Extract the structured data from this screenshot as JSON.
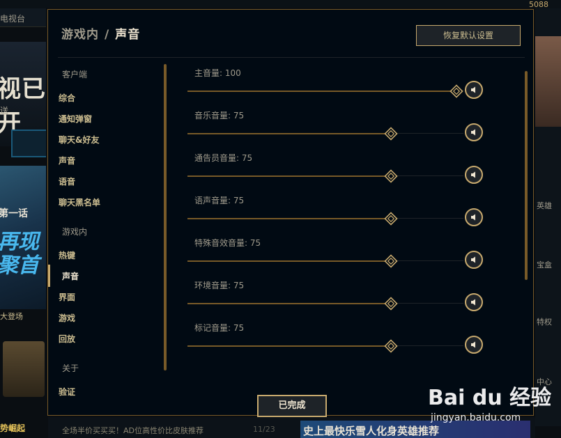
{
  "background": {
    "gold_amount": "5088",
    "left_nav_label": "电视台",
    "banner_big_text": "视已开",
    "banner_small_text": "送",
    "promo_line1": "第一话",
    "promo_line2": "再现",
    "promo_line3": "聚首",
    "promo_caption": "大登场",
    "bottom_left_news": "全场半价买买买！AD位高性价比皮肤推荐",
    "bottom_page": "11/23",
    "bottom_right_banner": "史上最快乐雪人化身英雄推荐",
    "left_footer": "势崛起",
    "right_labels": [
      "英雄",
      "宝盒",
      "特权",
      "中心"
    ]
  },
  "modal": {
    "breadcrumb_parent": "游戏内",
    "breadcrumb_sep": "/",
    "breadcrumb_current": "声音",
    "reset_button": "恢复默认设置",
    "done_button": "已完成"
  },
  "sidebar": {
    "section_client": "客户端",
    "client_items": [
      "综合",
      "通知弹窗",
      "聊天&好友",
      "声音",
      "语音",
      "聊天黑名单"
    ],
    "section_ingame": "游戏内",
    "ingame_items": [
      "热键",
      "声音",
      "界面",
      "游戏",
      "回放"
    ],
    "active_item": "声音",
    "section_about": "关于",
    "about_items": [
      "验证"
    ]
  },
  "volumes": [
    {
      "label": "主音量: 100",
      "value": 100
    },
    {
      "label": "音乐音量: 75",
      "value": 75
    },
    {
      "label": "通告员音量: 75",
      "value": 75
    },
    {
      "label": "语声音量: 75",
      "value": 75
    },
    {
      "label": "特殊音效音量: 75",
      "value": 75
    },
    {
      "label": "环境音量: 75",
      "value": 75
    },
    {
      "label": "标记音量: 75",
      "value": 75
    }
  ],
  "watermark": {
    "logo": "Bai du 经验",
    "url": "jingyan.baidu.com"
  },
  "colors": {
    "gold": "#c8aa6e",
    "gold_dark": "#785a28",
    "panel_bg": "#010a13",
    "text_light": "#f0e6d2",
    "text_muted": "#a09b8c"
  },
  "icons": {
    "mute": "speaker-icon",
    "thumb": "diamond-slider-thumb"
  }
}
